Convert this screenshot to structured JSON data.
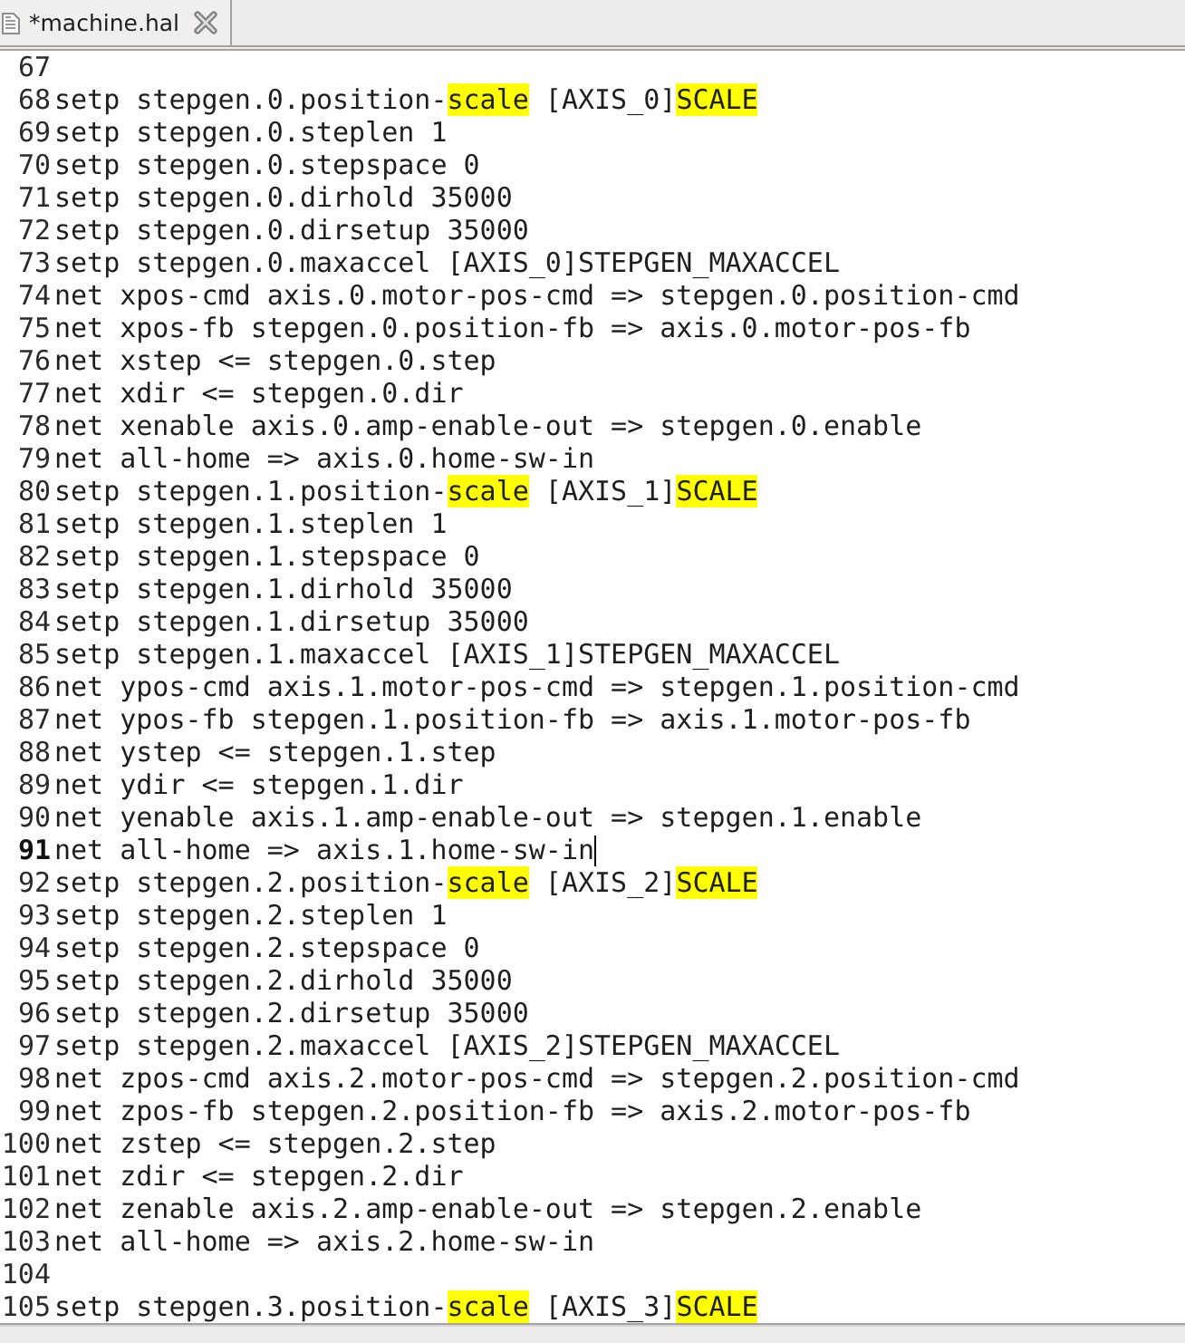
{
  "tabs": [
    {
      "title": "*machine.hal",
      "selected": true
    }
  ],
  "editor": {
    "lines": [
      {
        "number": "67",
        "current": false
      },
      {
        "number": "68",
        "current": false,
        "segments": [
          {
            "text": "setp stepgen.0.position-",
            "highlighted": false
          },
          {
            "text": "scale",
            "highlighted": true
          },
          {
            "text": " [AXIS_0]",
            "highlighted": false
          },
          {
            "text": "SCALE",
            "highlighted": true
          }
        ]
      },
      {
        "number": "69",
        "current": false,
        "text": "setp stepgen.0.steplen 1"
      },
      {
        "number": "70",
        "current": false,
        "text": "setp stepgen.0.stepspace 0"
      },
      {
        "number": "71",
        "current": false,
        "text": "setp stepgen.0.dirhold 35000"
      },
      {
        "number": "72",
        "current": false,
        "text": "setp stepgen.0.dirsetup 35000"
      },
      {
        "number": "73",
        "current": false,
        "text": "setp stepgen.0.maxaccel [AXIS_0]STEPGEN_MAXACCEL"
      },
      {
        "number": "74",
        "current": false,
        "text": "net xpos-cmd axis.0.motor-pos-cmd => stepgen.0.position-cmd"
      },
      {
        "number": "75",
        "current": false,
        "text": "net xpos-fb stepgen.0.position-fb => axis.0.motor-pos-fb"
      },
      {
        "number": "76",
        "current": false,
        "text": "net xstep <= stepgen.0.step"
      },
      {
        "number": "77",
        "current": false,
        "text": "net xdir <= stepgen.0.dir"
      },
      {
        "number": "78",
        "current": false,
        "text": "net xenable axis.0.amp-enable-out => stepgen.0.enable"
      },
      {
        "number": "79",
        "current": false,
        "text": "net all-home => axis.0.home-sw-in"
      },
      {
        "number": "80",
        "current": false,
        "segments": [
          {
            "text": "setp stepgen.1.position-",
            "highlighted": false
          },
          {
            "text": "scale",
            "highlighted": true
          },
          {
            "text": " [AXIS_1]",
            "highlighted": false
          },
          {
            "text": "SCALE",
            "highlighted": true
          }
        ]
      },
      {
        "number": "81",
        "current": false,
        "text": "setp stepgen.1.steplen 1"
      },
      {
        "number": "82",
        "current": false,
        "text": "setp stepgen.1.stepspace 0"
      },
      {
        "number": "83",
        "current": false,
        "text": "setp stepgen.1.dirhold 35000"
      },
      {
        "number": "84",
        "current": false,
        "text": "setp stepgen.1.dirsetup 35000"
      },
      {
        "number": "85",
        "current": false,
        "text": "setp stepgen.1.maxaccel [AXIS_1]STEPGEN_MAXACCEL"
      },
      {
        "number": "86",
        "current": false,
        "text": "net ypos-cmd axis.1.motor-pos-cmd => stepgen.1.position-cmd"
      },
      {
        "number": "87",
        "current": false,
        "text": "net ypos-fb stepgen.1.position-fb => axis.1.motor-pos-fb"
      },
      {
        "number": "88",
        "current": false,
        "text": "net ystep <= stepgen.1.step"
      },
      {
        "number": "89",
        "current": false,
        "text": "net ydir <= stepgen.1.dir"
      },
      {
        "number": "90",
        "current": false,
        "text": "net yenable axis.1.amp-enable-out => stepgen.1.enable"
      },
      {
        "number": "91",
        "current": true,
        "text": "net all-home => axis.1.home-sw-in"
      },
      {
        "number": "92",
        "current": false,
        "segments": [
          {
            "text": "setp stepgen.2.position-",
            "highlighted": false
          },
          {
            "text": "scale",
            "highlighted": true
          },
          {
            "text": " [AXIS_2]",
            "highlighted": false
          },
          {
            "text": "SCALE",
            "highlighted": true
          }
        ]
      },
      {
        "number": "93",
        "current": false,
        "text": "setp stepgen.2.steplen 1"
      },
      {
        "number": "94",
        "current": false,
        "text": "setp stepgen.2.stepspace 0"
      },
      {
        "number": "95",
        "current": false,
        "text": "setp stepgen.2.dirhold 35000"
      },
      {
        "number": "96",
        "current": false,
        "text": "setp stepgen.2.dirsetup 35000"
      },
      {
        "number": "97",
        "current": false,
        "text": "setp stepgen.2.maxaccel [AXIS_2]STEPGEN_MAXACCEL"
      },
      {
        "number": "98",
        "current": false,
        "text": "net zpos-cmd axis.2.motor-pos-cmd => stepgen.2.position-cmd"
      },
      {
        "number": "99",
        "current": false,
        "text": "net zpos-fb stepgen.2.position-fb => axis.2.motor-pos-fb"
      },
      {
        "number": "100",
        "current": false,
        "text": "net zstep <= stepgen.2.step"
      },
      {
        "number": "101",
        "current": false,
        "text": "net zdir <= stepgen.2.dir"
      },
      {
        "number": "102",
        "current": false,
        "text": "net zenable axis.2.amp-enable-out => stepgen.2.enable"
      },
      {
        "number": "103",
        "current": false,
        "text": "net all-home => axis.2.home-sw-in"
      },
      {
        "number": "104",
        "current": false
      },
      {
        "number": "105",
        "current": false,
        "segments": [
          {
            "text": "setp stepgen.3.position-",
            "highlighted": false
          },
          {
            "text": "scale",
            "highlighted": true
          },
          {
            "text": " [AXIS_3]",
            "highlighted": false
          },
          {
            "text": "SCALE",
            "highlighted": true
          }
        ]
      }
    ]
  }
}
